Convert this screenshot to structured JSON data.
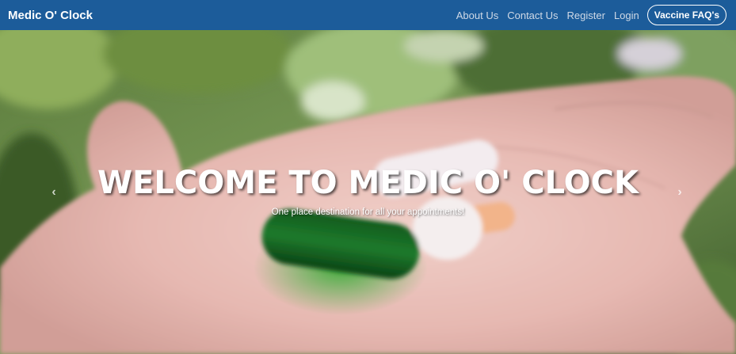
{
  "navbar": {
    "brand": "Medic O' Clock",
    "links": [
      "About Us",
      "Contact Us",
      "Register",
      "Login"
    ],
    "faq_button": "Vaccine FAQ's"
  },
  "hero": {
    "title": "WELCOME TO MEDIC O' CLOCK",
    "subtitle": "One place destination for all your appointments!",
    "prev_icon": "‹",
    "next_icon": "›"
  },
  "colors": {
    "navbar_bg": "#1c5c9a",
    "text_white": "#ffffff"
  }
}
